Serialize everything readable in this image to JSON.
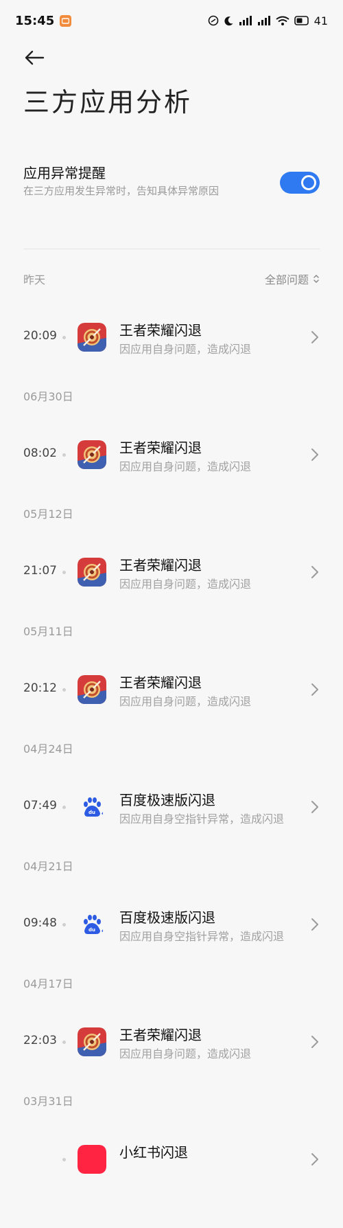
{
  "status_bar": {
    "time": "15:45",
    "battery": "41",
    "colors": {
      "notification": "#f28b3c"
    }
  },
  "header": {
    "title": "三方应用分析"
  },
  "setting": {
    "title": "应用异常提醒",
    "description": "在三方应用发生异常时，告知具体异常原因",
    "enabled": true,
    "accent_color": "#2f7af0"
  },
  "filter": {
    "first_date": "昨天",
    "select_label": "全部问题"
  },
  "items": [
    {
      "time": "20:09",
      "icon": "honor-of-kings-icon",
      "title": "王者荣耀闪退",
      "subtitle": "因应用自身问题，造成闪退",
      "next_date": "06月30日"
    },
    {
      "time": "08:02",
      "icon": "honor-of-kings-icon",
      "title": "王者荣耀闪退",
      "subtitle": "因应用自身问题，造成闪退",
      "next_date": "05月12日"
    },
    {
      "time": "21:07",
      "icon": "honor-of-kings-icon",
      "title": "王者荣耀闪退",
      "subtitle": "因应用自身问题，造成闪退",
      "next_date": "05月11日"
    },
    {
      "time": "20:12",
      "icon": "honor-of-kings-icon",
      "title": "王者荣耀闪退",
      "subtitle": "因应用自身问题，造成闪退",
      "next_date": "04月24日"
    },
    {
      "time": "07:49",
      "icon": "baidu-icon",
      "title": "百度极速版闪退",
      "subtitle": "因应用自身空指针异常，造成闪退",
      "next_date": "04月21日"
    },
    {
      "time": "09:48",
      "icon": "baidu-icon",
      "title": "百度极速版闪退",
      "subtitle": "因应用自身空指针异常，造成闪退",
      "next_date": "04月17日"
    },
    {
      "time": "22:03",
      "icon": "honor-of-kings-icon",
      "title": "王者荣耀闪退",
      "subtitle": "因应用自身问题，造成闪退",
      "next_date": "03月31日"
    },
    {
      "time": "",
      "icon": "xiaohongshu-icon",
      "title": "小红书闪退",
      "subtitle": "",
      "next_date": ""
    }
  ]
}
